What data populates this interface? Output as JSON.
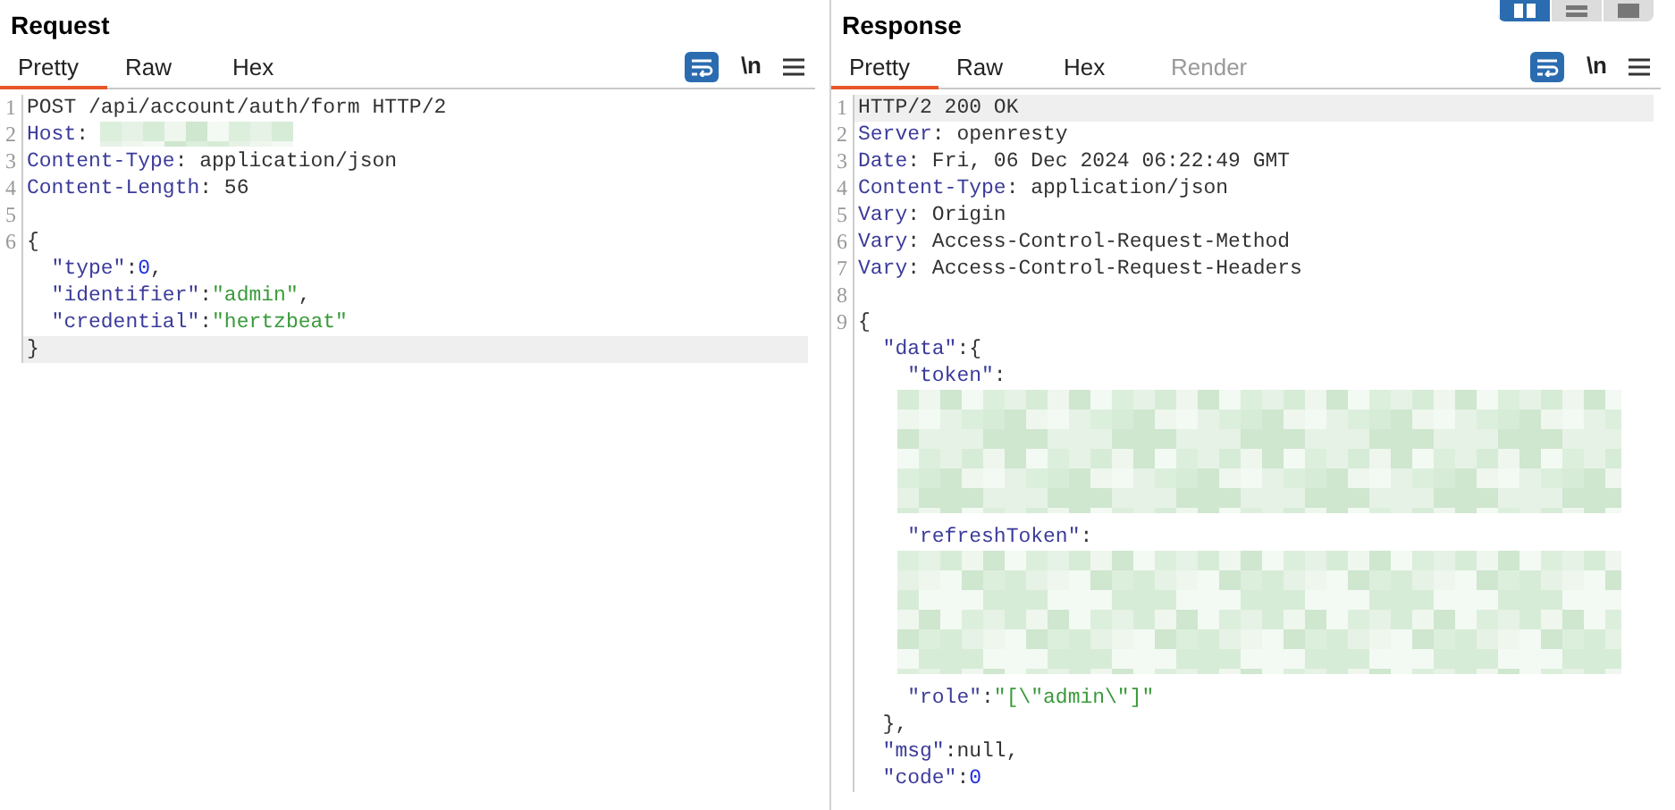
{
  "layout_buttons": [
    {
      "kind": "columns",
      "selected": true
    },
    {
      "kind": "rows",
      "selected": false
    },
    {
      "kind": "single",
      "selected": false
    }
  ],
  "panes": [
    {
      "title": "Request",
      "tabs": [
        {
          "label": "Pretty",
          "selected": true,
          "disabled": false
        },
        {
          "label": "Raw",
          "selected": false,
          "disabled": false
        },
        {
          "label": "Hex",
          "selected": false,
          "disabled": false
        }
      ],
      "tools": {
        "wrap_on": true,
        "newline_label": "\\n"
      },
      "lines": [
        {
          "number": "1",
          "highlighted": false,
          "segments": [
            {
              "kind": "plain",
              "text": "POST /api/account/auth/form HTTP/2"
            }
          ]
        },
        {
          "number": "2",
          "highlighted": false,
          "segments": [
            {
              "kind": "header",
              "text": "Host"
            },
            {
              "kind": "plain",
              "text": ":"
            },
            {
              "kind": "redacted"
            }
          ]
        },
        {
          "number": "3",
          "highlighted": false,
          "segments": [
            {
              "kind": "header",
              "text": "Content-Type"
            },
            {
              "kind": "plain",
              "text": ": application/json"
            }
          ]
        },
        {
          "number": "4",
          "highlighted": false,
          "segments": [
            {
              "kind": "header",
              "text": "Content-Length"
            },
            {
              "kind": "plain",
              "text": ": 56"
            }
          ]
        },
        {
          "number": "5",
          "highlighted": false
        },
        {
          "number": "6",
          "highlighted": false,
          "segments": [
            {
              "kind": "plain",
              "text": "{"
            }
          ]
        },
        {
          "highlighted": false,
          "segments": [
            {
              "kind": "key",
              "text": "  \"type\""
            },
            {
              "kind": "plain",
              "text": ":"
            },
            {
              "kind": "number",
              "text": "0"
            },
            {
              "kind": "plain",
              "text": ","
            }
          ]
        },
        {
          "highlighted": false,
          "segments": [
            {
              "kind": "key",
              "text": "  \"identifier\""
            },
            {
              "kind": "plain",
              "text": ":"
            },
            {
              "kind": "string",
              "text": "\"admin\""
            },
            {
              "kind": "plain",
              "text": ","
            }
          ]
        },
        {
          "highlighted": false,
          "segments": [
            {
              "kind": "key",
              "text": "  \"credential\""
            },
            {
              "kind": "plain",
              "text": ":"
            },
            {
              "kind": "string",
              "text": "\"hertzbeat\""
            }
          ]
        },
        {
          "highlighted": true,
          "segments": [
            {
              "kind": "plain",
              "text": "}"
            }
          ]
        }
      ]
    },
    {
      "title": "Response",
      "tabs": [
        {
          "label": "Pretty",
          "selected": true,
          "disabled": false
        },
        {
          "label": "Raw",
          "selected": false,
          "disabled": false
        },
        {
          "label": "Hex",
          "selected": false,
          "disabled": false
        },
        {
          "label": "Render",
          "selected": false,
          "disabled": true
        }
      ],
      "tools": {
        "wrap_on": true,
        "newline_label": "\\n"
      },
      "lines": [
        {
          "number": "1",
          "highlighted": true,
          "segments": [
            {
              "kind": "plain",
              "text": "HTTP/2 200 OK"
            }
          ]
        },
        {
          "number": "2",
          "highlighted": false,
          "segments": [
            {
              "kind": "header",
              "text": "Server"
            },
            {
              "kind": "plain",
              "text": ": openresty"
            }
          ]
        },
        {
          "number": "3",
          "highlighted": false,
          "segments": [
            {
              "kind": "header",
              "text": "Date"
            },
            {
              "kind": "plain",
              "text": ": Fri, 06 Dec 2024 06:22:49 GMT"
            }
          ]
        },
        {
          "number": "4",
          "highlighted": false,
          "segments": [
            {
              "kind": "header",
              "text": "Content-Type"
            },
            {
              "kind": "plain",
              "text": ": application/json"
            }
          ]
        },
        {
          "number": "5",
          "highlighted": false,
          "segments": [
            {
              "kind": "header",
              "text": "Vary"
            },
            {
              "kind": "plain",
              "text": ": Origin"
            }
          ]
        },
        {
          "number": "6",
          "highlighted": false,
          "segments": [
            {
              "kind": "header",
              "text": "Vary"
            },
            {
              "kind": "plain",
              "text": ": Access-Control-Request-Method"
            }
          ]
        },
        {
          "number": "7",
          "highlighted": false,
          "segments": [
            {
              "kind": "header",
              "text": "Vary"
            },
            {
              "kind": "plain",
              "text": ": Access-Control-Request-Headers"
            }
          ]
        },
        {
          "number": "8",
          "highlighted": false
        },
        {
          "number": "9",
          "highlighted": false,
          "segments": [
            {
              "kind": "plain",
              "text": "{"
            }
          ]
        },
        {
          "highlighted": false,
          "segments": [
            {
              "kind": "key",
              "text": "  \"data\""
            },
            {
              "kind": "plain",
              "text": ":{"
            }
          ]
        },
        {
          "highlighted": false,
          "segments": [
            {
              "kind": "key",
              "text": "    \"token\""
            },
            {
              "kind": "plain",
              "text": ":"
            }
          ]
        },
        {
          "highlighted": false,
          "segments": [
            {
              "kind": "redacted_block"
            }
          ]
        },
        {
          "highlighted": false,
          "segments": [
            {
              "kind": "key",
              "text": "    \"refreshToken\""
            },
            {
              "kind": "plain",
              "text": ":"
            }
          ]
        },
        {
          "highlighted": false,
          "segments": [
            {
              "kind": "redacted_block"
            }
          ]
        },
        {
          "highlighted": false,
          "segments": [
            {
              "kind": "key",
              "text": "    \"role\""
            },
            {
              "kind": "plain",
              "text": ":"
            },
            {
              "kind": "string",
              "text": "\"[\\\"admin\\\"]\""
            }
          ]
        },
        {
          "highlighted": false,
          "segments": [
            {
              "kind": "plain",
              "text": "  },"
            }
          ]
        },
        {
          "highlighted": false,
          "segments": [
            {
              "kind": "key",
              "text": "  \"msg\""
            },
            {
              "kind": "plain",
              "text": ":null,"
            }
          ]
        },
        {
          "highlighted": false,
          "segments": [
            {
              "kind": "key",
              "text": "  \"code\""
            },
            {
              "kind": "plain",
              "text": ":"
            },
            {
              "kind": "number",
              "text": "0"
            }
          ]
        }
      ]
    }
  ]
}
